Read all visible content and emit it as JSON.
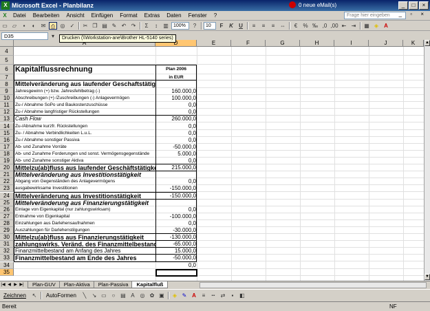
{
  "window": {
    "title": "Microsoft Excel - Planbilanz",
    "mail_notice": "0 neue eMail(s)"
  },
  "menu": {
    "items": [
      "Datei",
      "Bearbeiten",
      "Ansicht",
      "Einfügen",
      "Format",
      "Extras",
      "Daten",
      "Fenster",
      "?"
    ],
    "help_placeholder": "Frage hier eingeben"
  },
  "toolbar": {
    "zoom": "100%",
    "font_size": "10",
    "bold": "F",
    "italic": "K",
    "underline": "U",
    "sum": "Σ"
  },
  "tooltip": "Drucken (\\\\Workstation-ane\\Brother HL-5140 series)",
  "formula_bar": {
    "name_box": "D35"
  },
  "columns": [
    "A",
    "D",
    "E",
    "F",
    "G",
    "H",
    "I",
    "J",
    "K"
  ],
  "selected_column": "D",
  "sheet": {
    "rows": [
      {
        "num": "4",
        "a": "",
        "d": ""
      },
      {
        "num": "5",
        "a": "",
        "d": ""
      },
      {
        "num": "6",
        "a": "Kapitalflussrechnung",
        "d": "Plan 2006"
      },
      {
        "num": "7",
        "a": "",
        "d": "in EUR"
      },
      {
        "num": "8",
        "a": "Mittelveränderung aus laufender Geschaftstätigkeit",
        "d": ""
      },
      {
        "num": "9",
        "a": "Jahresgewinn (+) bzw. Jahresfehlbetrag (-)",
        "d": "160.000,0"
      },
      {
        "num": "10",
        "a": "Abschreibungen (+) /Zuschreibungen (-) Anlagevermögen",
        "d": "100.000,0"
      },
      {
        "num": "11",
        "a": "Zu-/ Abnahme SoPo und Baukostenzuschüsse",
        "d": "0,0"
      },
      {
        "num": "12",
        "a": "Zu-/ Abnahme langfristiger Rückstellungen",
        "d": "0,0"
      },
      {
        "num": "13",
        "a": "Cash Flow",
        "d": "260.000,0"
      },
      {
        "num": "14",
        "a": "Zu-/Abnahme kurzfr. Rückstellungen",
        "d": "0,0"
      },
      {
        "num": "15",
        "a": "Zu- / Abnahme Verbindlichkeiten L.u.L.",
        "d": "0,0"
      },
      {
        "num": "16",
        "a": "Zu-/ Abnahme sonstiger Passiva",
        "d": "0,0"
      },
      {
        "num": "17",
        "a": "Ab- und Zunahme Vorräte",
        "d": "-50.000,0"
      },
      {
        "num": "18",
        "a": "Ab- und Zunahme Forderungen und sonst. Vermögensgegenstände",
        "d": "5.000,0"
      },
      {
        "num": "19",
        "a": "Ab- und Zunahme sonstiger Aktiva",
        "d": "0,0"
      },
      {
        "num": "20",
        "a": "Mittelzu(ab)fluss aus laufender Geschäftstätigkeit",
        "d": "215.000,0"
      },
      {
        "num": "21",
        "a": "Mittelveränderung aus Investitionstätigkeit",
        "d": ""
      },
      {
        "num": "22",
        "a": "Abgang von Gegenständen des Anlagevermögens",
        "d": "0,0"
      },
      {
        "num": "23",
        "a": "ausgabewirksame Investitionen",
        "d": "-150.000,0"
      },
      {
        "num": "24",
        "a": "Mittelveränderung aus Investitionstätigkeit",
        "d": "-150.000,0"
      },
      {
        "num": "25",
        "a": "Mittelveränderung aus Finanzierungstätigkeit",
        "d": ""
      },
      {
        "num": "26",
        "a": "Einlage von Eigenkapital (nur zahlungswirksam)",
        "d": "0,0"
      },
      {
        "num": "27",
        "a": "Entnahme von Eigenkapital",
        "d": "-100.000,0"
      },
      {
        "num": "28",
        "a": "Einzahlungen aus Darlehensaufnahmen",
        "d": "0,0"
      },
      {
        "num": "29",
        "a": "Auszahlungen für Darlehenstilgungen",
        "d": "-30.000,0"
      },
      {
        "num": "30",
        "a": "Mittelzu(ab)fluss aus Finanzierungstätigkeit",
        "d": "-130.000,0"
      },
      {
        "num": "31",
        "a": "zahlungswirks. Veränd. des Finanzmittelbestandes",
        "d": "-65.000,0"
      },
      {
        "num": "32",
        "a": "Finanzmittelbestand am Anfang des Jahres",
        "d": "15.000,0"
      },
      {
        "num": "33",
        "a": "Finanzmittelbestand am Ende des Jahres",
        "d": "-50.000,0"
      },
      {
        "num": "34",
        "a": "",
        "d": "0,0"
      },
      {
        "num": "35",
        "a": "",
        "d": ""
      }
    ]
  },
  "tabs": [
    "Plan-GUV",
    "Plan-Aktiva",
    "Plan-Passiva",
    "Kapitalfluß"
  ],
  "active_tab": "Kapitalfluß",
  "draw_toolbar": {
    "draw_label": "Zeichnen",
    "autoshapes_label": "AutoFormen"
  },
  "status": {
    "left": "Bereit",
    "right": "NF"
  }
}
